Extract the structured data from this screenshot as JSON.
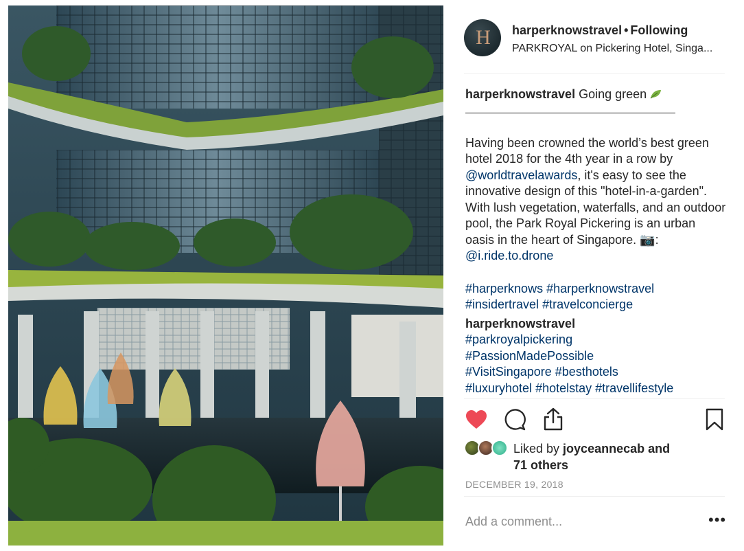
{
  "post": {
    "username": "harperknowstravel",
    "follow_status": "Following",
    "location": "PARKROYAL on Pickering Hotel, Singa...",
    "avatar_letter": "H"
  },
  "caption": {
    "username": "harperknowstravel",
    "headline": "Going green",
    "body_1": "Having been crowned the world’s best green hotel 2018 for the 4th year in a row by ",
    "mention_1": "@worldtravelawards",
    "body_2": ", it's easy to see the innovative design of this \"hotel-in-a-garden\". With lush vegetation, waterfalls, and an outdoor pool, the Park Royal Pickering is an urban oasis in the heart of Singapore. 📷: ",
    "mention_2": "@i.ride.to.drone",
    "hashtags": [
      "#harperknows",
      "#harperknowstravel",
      "#insidertravel",
      "#travelconcierge"
    ]
  },
  "comment": {
    "username": "harperknowstravel",
    "hashtags": [
      "#parkroyalpickering",
      "#PassionMadePossible",
      "#VisitSingapore",
      "#besthotels",
      "#luxuryhotel",
      "#hotelstay",
      "#travellifestyle"
    ]
  },
  "likes": {
    "prefix": "Liked by ",
    "user": "joyceannecab",
    "middle": " and",
    "others": "71 others"
  },
  "date": "DECEMBER 19, 2018",
  "add_comment_placeholder": "Add a comment...",
  "more_label": "•••",
  "icons": {
    "like": "heart-icon",
    "comment": "comment-icon",
    "share": "share-icon",
    "save": "bookmark-icon",
    "more": "more-options-icon"
  },
  "colors": {
    "liked_heart": "#ed4956",
    "link": "#003569",
    "muted": "#8e8e8e"
  }
}
